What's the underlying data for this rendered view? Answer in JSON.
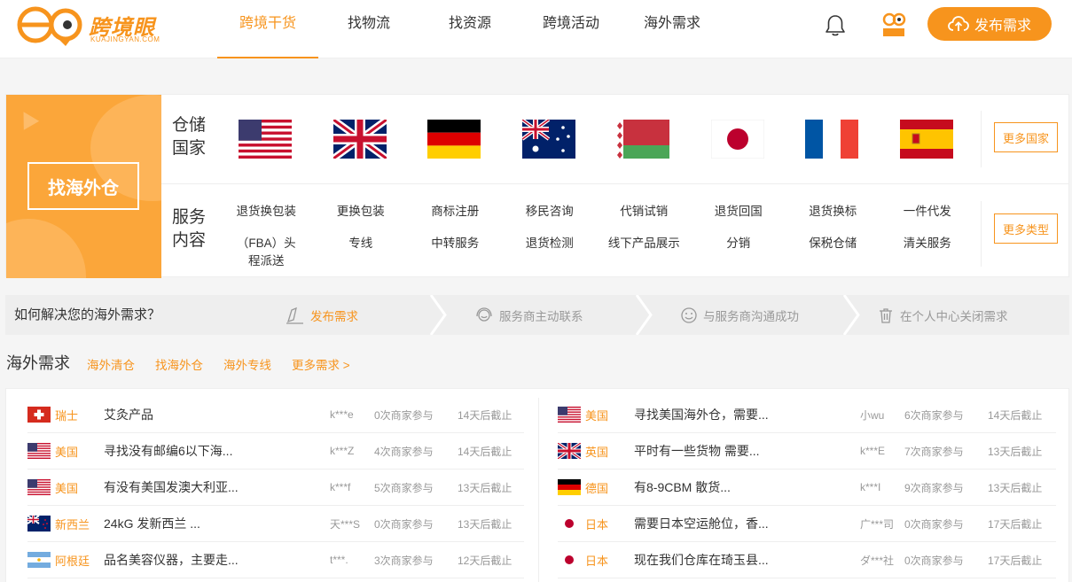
{
  "brand": {
    "name": "跨境眼",
    "domain": "KUAJINGYAN.COM",
    "mini_logo_text": "跨境眼"
  },
  "nav": [
    {
      "label": "跨境干货",
      "active": true
    },
    {
      "label": "找物流",
      "active": false
    },
    {
      "label": "找资源",
      "active": false
    },
    {
      "label": "跨境活动",
      "active": false
    },
    {
      "label": "海外需求",
      "active": false
    }
  ],
  "header": {
    "publish_label": "发布需求"
  },
  "warehouse": {
    "banner_label": "找海外仓",
    "country_label": "仓储\n国家",
    "service_label": "服务\n内容",
    "flags": [
      "us",
      "uk",
      "de",
      "au",
      "by",
      "jp",
      "fr",
      "es"
    ],
    "more_countries": "更多国家",
    "more_types": "更多类型",
    "services_row1": [
      "退货换包装",
      "更换包装",
      "商标注册",
      "移民咨询",
      "代销试销",
      "退货回国",
      "退货换标",
      "一件代发"
    ],
    "services_row2": [
      "（FBA）头程派送",
      "专线",
      "中转服务",
      "退货检测",
      "线下产品展示",
      "分销",
      "保税仓储",
      "清关服务"
    ]
  },
  "howto": {
    "question": "如何解决您的海外需求？",
    "steps": [
      "发布需求",
      "服务商主动联系",
      "与服务商沟通成功",
      "在个人中心关闭需求"
    ]
  },
  "demands": {
    "section_title": "海外需求",
    "tags": [
      "海外清仓",
      "找海外仓",
      "海外专线",
      "更多需求 >"
    ],
    "left": [
      {
        "flag": "ch",
        "country": "瑞士",
        "title": "艾灸产品",
        "user": "k***e",
        "count": "0次商家参与",
        "deadline": "14天后截止"
      },
      {
        "flag": "us",
        "country": "美国",
        "title": "寻找没有邮编6以下海...",
        "user": "k***Z",
        "count": "4次商家参与",
        "deadline": "14天后截止"
      },
      {
        "flag": "us",
        "country": "美国",
        "title": "有没有美国发澳大利亚...",
        "user": "k***f",
        "count": "5次商家参与",
        "deadline": "13天后截止"
      },
      {
        "flag": "nz",
        "country": "新西兰",
        "title": "24kG 发新西兰 ...",
        "user": "天***S",
        "count": "0次商家参与",
        "deadline": "13天后截止"
      },
      {
        "flag": "ar",
        "country": "阿根廷",
        "title": "品名美容仪器，主要走...",
        "user": "t***.",
        "count": "3次商家参与",
        "deadline": "12天后截止"
      }
    ],
    "right": [
      {
        "flag": "us",
        "country": "美国",
        "title": "寻找美国海外仓，需要...",
        "user": "小wu",
        "count": "6次商家参与",
        "deadline": "14天后截止"
      },
      {
        "flag": "uk",
        "country": "英国",
        "title": "平时有一些货物 需要...",
        "user": "k***E",
        "count": "7次商家参与",
        "deadline": "13天后截止"
      },
      {
        "flag": "de",
        "country": "德国",
        "title": "有8-9CBM 散货...",
        "user": "k***I",
        "count": "9次商家参与",
        "deadline": "13天后截止"
      },
      {
        "flag": "jp",
        "country": "日本",
        "title": "需要日本空运舱位，香...",
        "user": "广***司",
        "count": "0次商家参与",
        "deadline": "17天后截止"
      },
      {
        "flag": "jp",
        "country": "日本",
        "title": "现在我们仓库在琦玉县...",
        "user": "ダ***社",
        "count": "0次商家参与",
        "deadline": "17天后截止"
      }
    ]
  },
  "colors": {
    "accent": "#f7941d",
    "banner": "#fba63a"
  }
}
